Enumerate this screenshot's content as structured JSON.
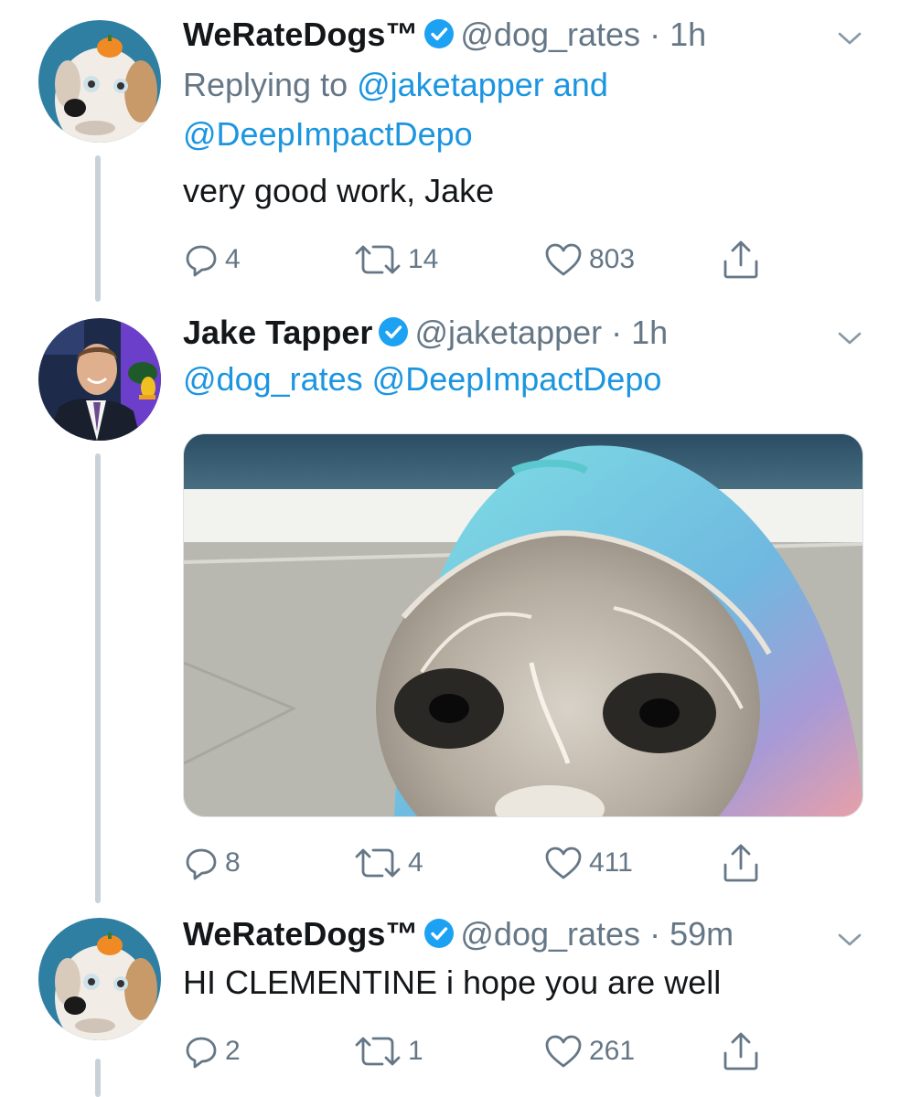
{
  "tweets": [
    {
      "name": "WeRateDogs™",
      "handle": "@dog_rates",
      "time": "1h",
      "replying_prefix": "Replying to ",
      "replying_user1": "@jaketapper",
      "replying_and": " and",
      "replying_user2": "@DeepImpactDepo",
      "text": "very good work, Jake",
      "replies": "4",
      "retweets": "14",
      "likes": "803"
    },
    {
      "name": "Jake Tapper",
      "handle": "@jaketapper",
      "time": "1h",
      "mentions": "@dog_rates @DeepImpactDepo",
      "replies": "8",
      "retweets": "4",
      "likes": "411"
    },
    {
      "name": "WeRateDogs™",
      "handle": "@dog_rates",
      "time": "59m",
      "text": "HI CLEMENTINE i hope you are well",
      "replies": "2",
      "retweets": "1",
      "likes": "261"
    }
  ],
  "separator": " · ",
  "colors": {
    "link_blue": "#1b95e0",
    "meta_gray": "#657786",
    "verified_blue": "#1da1f2",
    "thread_line": "#c9d2d9"
  },
  "icons": [
    "verified-badge-icon",
    "chevron-down-icon",
    "reply-icon",
    "retweet-icon",
    "like-icon",
    "share-icon"
  ]
}
